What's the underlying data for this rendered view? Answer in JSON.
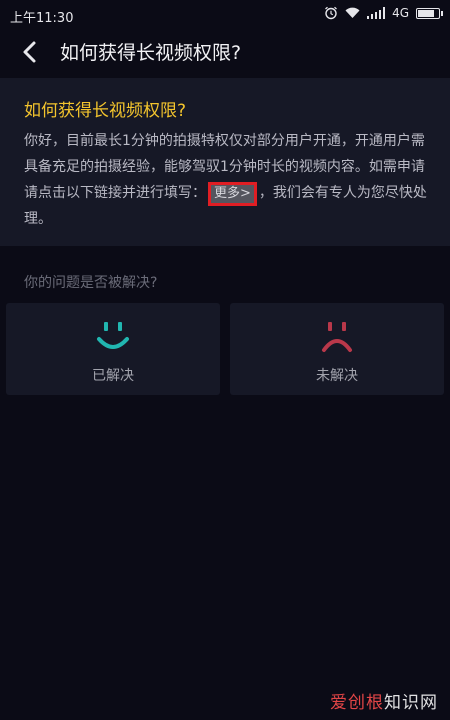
{
  "statusbar": {
    "time": "上午11:30",
    "network": "4G",
    "icons": [
      "alarm-icon",
      "wifi-icon",
      "signal-icon",
      "battery-icon"
    ]
  },
  "header": {
    "title": "如何获得长视频权限?",
    "back_icon": "chevron-left-icon"
  },
  "answer": {
    "heading": "如何获得长视频权限?",
    "body_before_link": "你好，目前最长1分钟的拍摄特权仅对部分用户开通，开通用户需具备充足的拍摄经验，能够驾驭1分钟时长的视频内容。如需申请请点击以下链接并进行填写：",
    "link_label": "更多>",
    "body_after_link": "，我们会有专人为您尽快处理。"
  },
  "feedback": {
    "question": "你的问题是否被解决?",
    "resolved_label": "已解决",
    "unresolved_label": "未解决"
  },
  "watermark": {
    "text_part1": "爱创根",
    "text_part2": "知识网"
  },
  "colors": {
    "background": "#0b0b16",
    "card": "#161826",
    "accent_yellow": "#f3c42d",
    "smile_teal": "#21b6b0",
    "frown_red": "#b9384a",
    "highlight_red": "#e01e24"
  }
}
